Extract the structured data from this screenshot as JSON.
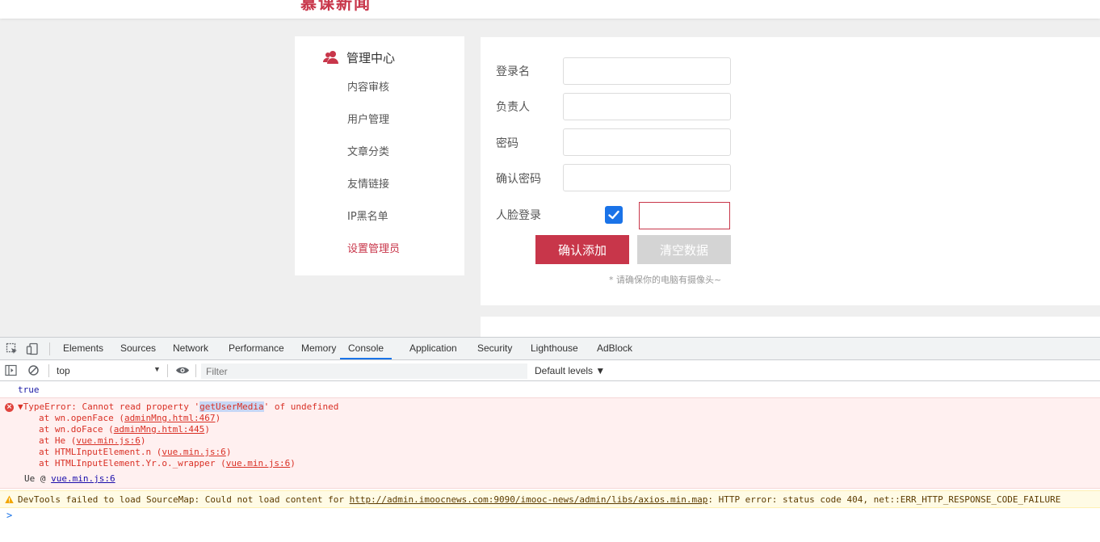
{
  "site": {
    "logo_text": "慕课新闻"
  },
  "sidebar": {
    "title": "管理中心",
    "items": [
      {
        "label": "内容审核"
      },
      {
        "label": "用户管理"
      },
      {
        "label": "文章分类"
      },
      {
        "label": "友情链接"
      },
      {
        "label": "IP黑名单"
      },
      {
        "label": "设置管理员",
        "active": true
      }
    ]
  },
  "form": {
    "login_label": "登录名",
    "login_value": "",
    "owner_label": "负责人",
    "owner_value": "",
    "password_label": "密码",
    "password_value": "",
    "confirm_password_label": "确认密码",
    "confirm_password_value": "",
    "face_login_label": "人脸登录",
    "face_login_checked": true,
    "confirm_button": "确认添加",
    "clear_button": "清空数据",
    "hint": "* 请确保你的电脑有摄像头~"
  },
  "colors": {
    "accent": "#c8364a",
    "devtools_blue": "#1a73e8",
    "error_red": "#d93025"
  },
  "devtools": {
    "tabs": [
      "Elements",
      "Sources",
      "Network",
      "Performance",
      "Memory",
      "Console",
      "Application",
      "Security",
      "Lighthouse",
      "AdBlock"
    ],
    "active_tab": "Console",
    "context": "top",
    "filter_placeholder": "Filter",
    "levels": "Default levels ▼",
    "console": {
      "log_true": "true",
      "error_prefix": "▼TypeError: Cannot read property '",
      "error_highlight": "getUserMedia",
      "error_suffix": "' of undefined",
      "stack": [
        {
          "text": "at wn.openFace (",
          "link": "adminMng.html:467",
          "end": ")"
        },
        {
          "text": "at wn.doFace (",
          "link": "adminMng.html:445",
          "end": ")"
        },
        {
          "text": "at He (",
          "link": "vue.min.js:6",
          "end": ")"
        },
        {
          "text": "at HTMLInputElement.n (",
          "link": "vue.min.js:6",
          "end": ")"
        },
        {
          "text": "at HTMLInputElement.Yr.o._wrapper (",
          "link": "vue.min.js:6",
          "end": ")"
        }
      ],
      "ue_prefix": "Ue @ ",
      "ue_link": "vue.min.js:6",
      "warning_prefix": "DevTools failed to load SourceMap: Could not load content for ",
      "warning_link": "http://admin.imoocnews.com:9090/imooc-news/admin/libs/axios.min.map",
      "warning_suffix": ": HTTP error: status code 404, net::ERR_HTTP_RESPONSE_CODE_FAILURE",
      "prompt": ">"
    }
  }
}
